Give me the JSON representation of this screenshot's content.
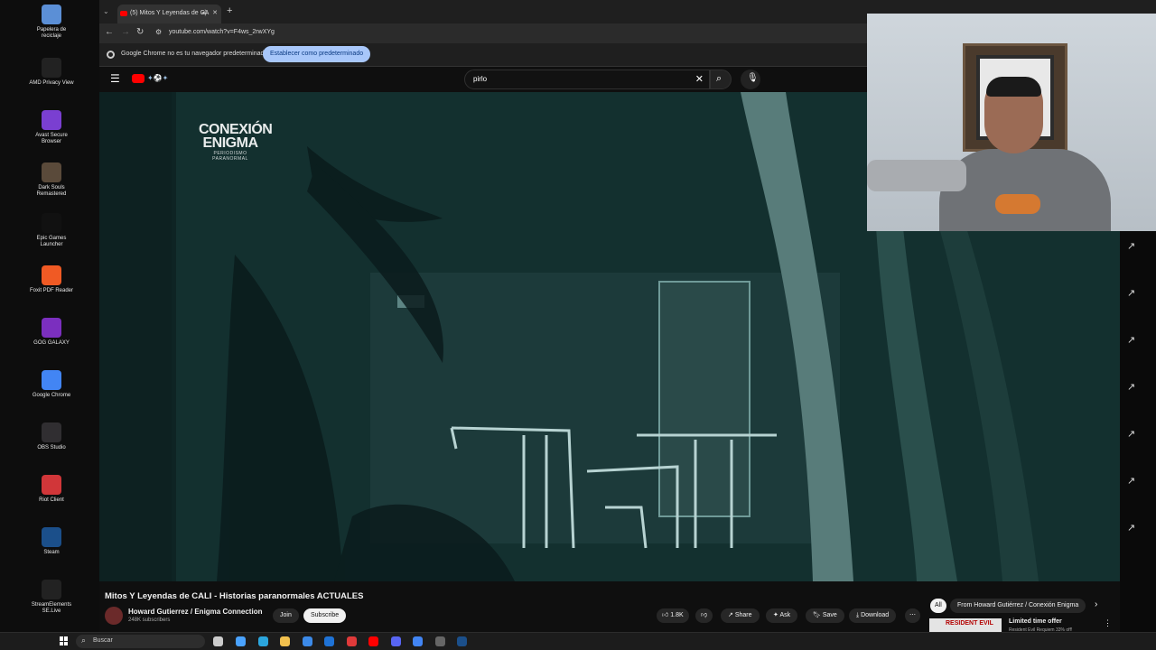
{
  "desktop": {
    "icons": [
      {
        "label": "Papelera de reciclaje",
        "icon": "recycle-bin-icon",
        "color": "#5b8fd6"
      },
      {
        "label": "AMD Privacy View",
        "icon": "amd-icon",
        "color": "#222222"
      },
      {
        "label": "Avast Secure Browser",
        "icon": "avast-icon",
        "color": "#7a3fd1"
      },
      {
        "label": "Dark Souls Remastered",
        "icon": "dark-souls-icon",
        "color": "#5a4a3a"
      },
      {
        "label": "Epic Games Launcher",
        "icon": "epic-icon",
        "color": "#111111"
      },
      {
        "label": "Foxit PDF Reader",
        "icon": "foxit-icon",
        "color": "#f05a24"
      },
      {
        "label": "GOG GALAXY",
        "icon": "gog-icon",
        "color": "#7b2fbf"
      },
      {
        "label": "Google Chrome",
        "icon": "chrome-icon",
        "color": "#4285f4"
      },
      {
        "label": "OBS Studio",
        "icon": "obs-icon",
        "color": "#302e31"
      },
      {
        "label": "Riot Client",
        "icon": "riot-icon",
        "color": "#d13639"
      },
      {
        "label": "Steam",
        "icon": "steam-icon",
        "color": "#1b4f8a"
      },
      {
        "label": "StreamElements SE.Live",
        "icon": "streamelements-icon",
        "color": "#222222"
      }
    ]
  },
  "browser": {
    "tab_title": "(5) Mitos Y Leyendas de CA",
    "url": "youtube.com/watch?v=F4ws_2rwXYg",
    "infobar_text": "Google Chrome no es tu navegador predeterminado",
    "infobar_button": "Establecer como predeterminado"
  },
  "youtube": {
    "search_value": "pirlo",
    "video_logo_title": "CONEXIÓN ENIGMA",
    "video_logo_subtitle": "PERIODISMO PARANORMAL",
    "video_title": "Mitos Y Leyendas de CALI - Historias paranormales ACTUALES",
    "channel_name": "Howard Gutierrez / Enigma Connection",
    "subscribers": "248K subscribers",
    "join_label": "Join",
    "subscribe_label": "Subscribe",
    "likes": "1.8K",
    "share_label": "Share",
    "ask_label": "Ask",
    "save_label": "Save",
    "download_label": "Download",
    "chip_all": "All",
    "chip_from": "From Howard Gutiérrez / Conexión Enigma",
    "offer_title": "Limited time offer",
    "offer_sub": "Resident Evil Requiem 33% off!",
    "offer_thumb": "RESIDENT EVIL"
  },
  "taskbar": {
    "search_placeholder": "Buscar"
  },
  "colors": {
    "accent_blue": "#a8c7fa",
    "youtube_red": "#ff0000"
  }
}
